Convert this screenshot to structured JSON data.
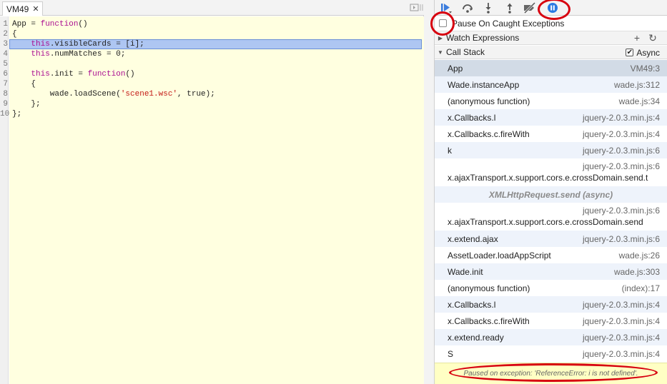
{
  "editor": {
    "tab_label": "VM49",
    "tab_close": "✕",
    "line_numbers": [
      "1",
      "2",
      "3",
      "4",
      "5",
      "6",
      "7",
      "8",
      "9",
      "10"
    ],
    "highlighted_line": "3"
  },
  "debugger": {
    "pause_caught_label": "Pause On Caught Exceptions",
    "watch_label": "Watch Expressions",
    "watch_add": "+",
    "watch_refresh": "↻",
    "callstack_label": "Call Stack",
    "async_label": "Async",
    "async_checked": true,
    "frames": [
      {
        "fn": "App",
        "loc": "VM49:3",
        "state": "sel"
      },
      {
        "fn": "Wade.instanceApp",
        "loc": "wade.js:312",
        "state": "alt"
      },
      {
        "fn": "(anonymous function)",
        "loc": "wade.js:34",
        "state": ""
      },
      {
        "fn": "x.Callbacks.l",
        "loc": "jquery-2.0.3.min.js:4",
        "state": "alt"
      },
      {
        "fn": "x.Callbacks.c.fireWith",
        "loc": "jquery-2.0.3.min.js:4",
        "state": ""
      },
      {
        "fn": "k",
        "loc": "jquery-2.0.3.min.js:6",
        "state": "alt"
      },
      {
        "fn": "x.ajaxTransport.x.support.cors.e.crossDomain.send.t",
        "loc": "jquery-2.0.3.min.js:6",
        "state": "tall"
      }
    ],
    "async_separator": "XMLHttpRequest.send (async)",
    "frames2": [
      {
        "fn": "x.ajaxTransport.x.support.cors.e.crossDomain.send",
        "loc": "jquery-2.0.3.min.js:6",
        "state": "tall"
      },
      {
        "fn": "x.extend.ajax",
        "loc": "jquery-2.0.3.min.js:6",
        "state": "alt"
      },
      {
        "fn": "AssetLoader.loadAppScript",
        "loc": "wade.js:26",
        "state": ""
      },
      {
        "fn": "Wade.init",
        "loc": "wade.js:303",
        "state": "alt"
      },
      {
        "fn": "(anonymous function)",
        "loc": "(index):17",
        "state": ""
      },
      {
        "fn": "x.Callbacks.l",
        "loc": "jquery-2.0.3.min.js:4",
        "state": "alt"
      },
      {
        "fn": "x.Callbacks.c.fireWith",
        "loc": "jquery-2.0.3.min.js:4",
        "state": ""
      },
      {
        "fn": "x.extend.ready",
        "loc": "jquery-2.0.3.min.js:4",
        "state": "alt"
      },
      {
        "fn": "S",
        "loc": "jquery-2.0.3.min.js:4",
        "state": ""
      }
    ],
    "status": "Paused on exception: 'ReferenceError: i is not defined'."
  },
  "colors": {
    "accent_blue": "#3b7ddd",
    "pause_blue": "#2a7ae2",
    "annotation_red": "#d7000f",
    "current_line": "#aec6f2"
  },
  "icons": {
    "resume": "resume-icon",
    "step_over": "step-over-icon",
    "step_into": "step-into-icon",
    "step_out": "step-out-icon",
    "deactivate": "deactivate-breakpoints-icon",
    "pause_exceptions": "pause-on-exceptions-icon"
  }
}
